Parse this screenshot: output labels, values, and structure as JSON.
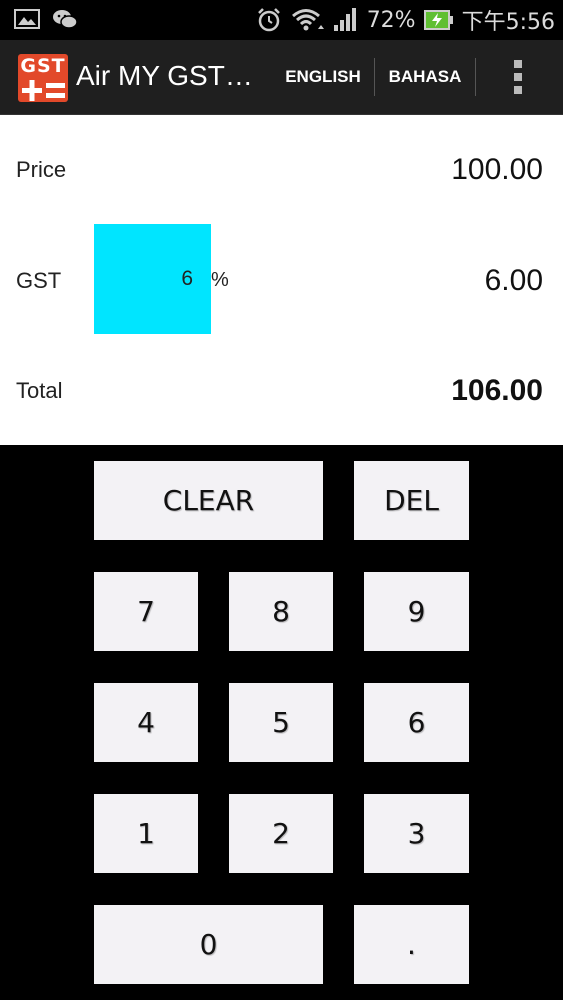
{
  "statusbar": {
    "battery": "72%",
    "time": "下午5:56"
  },
  "actionbar": {
    "logo_text": "GST",
    "title": "Air MY GST…",
    "english_label": "ENGLISH",
    "bahasa_label": "BAHASA"
  },
  "form": {
    "price_label": "Price",
    "price_value": "100.00",
    "gst_label": "GST",
    "gst_rate": "6",
    "percent_sign": "%",
    "gst_value": "6.00",
    "total_label": "Total",
    "total_value": "106.00",
    "gst_input_color": "#00e5ff"
  },
  "keypad": {
    "clear": "CLEAR",
    "del": "DEL",
    "k7": "7",
    "k8": "8",
    "k9": "9",
    "k4": "4",
    "k5": "5",
    "k6": "6",
    "k1": "1",
    "k2": "2",
    "k3": "3",
    "k0": "0",
    "dot": "."
  }
}
